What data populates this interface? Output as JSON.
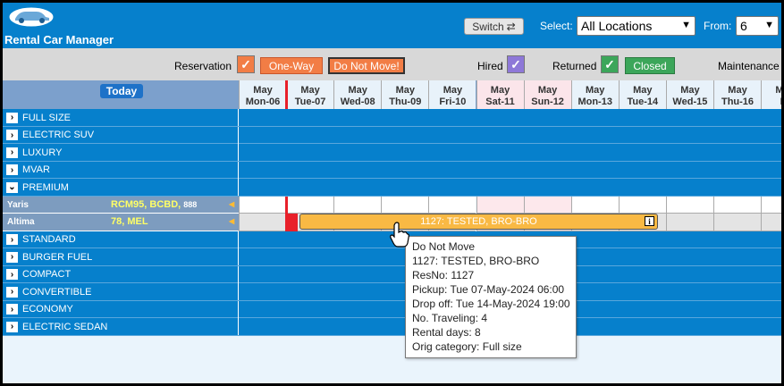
{
  "app": {
    "title": "Rental Car Manager",
    "logo": "car-logo"
  },
  "toolbar": {
    "switch_label": "Switch",
    "select_label": "Select:",
    "location_value": "All Locations",
    "from_label": "From:",
    "from_value": "6"
  },
  "legend": {
    "reservation": "Reservation",
    "one_way": "One-Way",
    "do_not_move": "Do Not Move!",
    "hired": "Hired",
    "returned": "Returned",
    "closed": "Closed",
    "maintenance": "Maintenance"
  },
  "colors": {
    "header_blue": "#0680cc",
    "reservation": "#f27d45",
    "hired": "#8e78d8",
    "returned": "#3ca65a",
    "booking": "#f9b944",
    "today_line": "#e8202a"
  },
  "timeline": {
    "today_label": "Today",
    "days": [
      {
        "month": "May",
        "day": "Mon-06",
        "weekend": false
      },
      {
        "month": "May",
        "day": "Tue-07",
        "weekend": false
      },
      {
        "month": "May",
        "day": "Wed-08",
        "weekend": false
      },
      {
        "month": "May",
        "day": "Thu-09",
        "weekend": false
      },
      {
        "month": "May",
        "day": "Fri-10",
        "weekend": false
      },
      {
        "month": "May",
        "day": "Sat-11",
        "weekend": true
      },
      {
        "month": "May",
        "day": "Sun-12",
        "weekend": true
      },
      {
        "month": "May",
        "day": "Mon-13",
        "weekend": false
      },
      {
        "month": "May",
        "day": "Tue-14",
        "weekend": false
      },
      {
        "month": "May",
        "day": "Wed-15",
        "weekend": false
      },
      {
        "month": "May",
        "day": "Thu-16",
        "weekend": false
      },
      {
        "month": "May",
        "day": "Fr",
        "weekend": false
      }
    ]
  },
  "categories": [
    {
      "name": "FULL SIZE",
      "expanded": false
    },
    {
      "name": "ELECTRIC SUV",
      "expanded": false
    },
    {
      "name": "LUXURY",
      "expanded": false
    },
    {
      "name": "MVAR",
      "expanded": false
    },
    {
      "name": "PREMIUM",
      "expanded": true
    },
    {
      "name": "STANDARD",
      "expanded": false
    },
    {
      "name": "BURGER FUEL",
      "expanded": false
    },
    {
      "name": "COMPACT",
      "expanded": false
    },
    {
      "name": "CONVERTIBLE",
      "expanded": false
    },
    {
      "name": "ECONOMY",
      "expanded": false
    },
    {
      "name": "ELECTRIC SEDAN",
      "expanded": false
    }
  ],
  "cars": [
    {
      "model": "Yaris",
      "units": "RCM95, BCBD,",
      "extra": "888"
    },
    {
      "model": "Altima",
      "units": "78, MEL",
      "extra": ""
    }
  ],
  "booking": {
    "label": "1127: TESTED, BRO-BRO",
    "info_icon": "info-icon"
  },
  "tooltip": {
    "lines": [
      "Do Not Move",
      "1127: TESTED, BRO-BRO",
      "ResNo: 1127",
      "Pickup: Tue 07-May-2024 06:00",
      "Drop off: Tue 14-May-2024 19:00",
      "No. Traveling: 4",
      "Rental days: 8",
      "Orig category: Full size"
    ]
  }
}
